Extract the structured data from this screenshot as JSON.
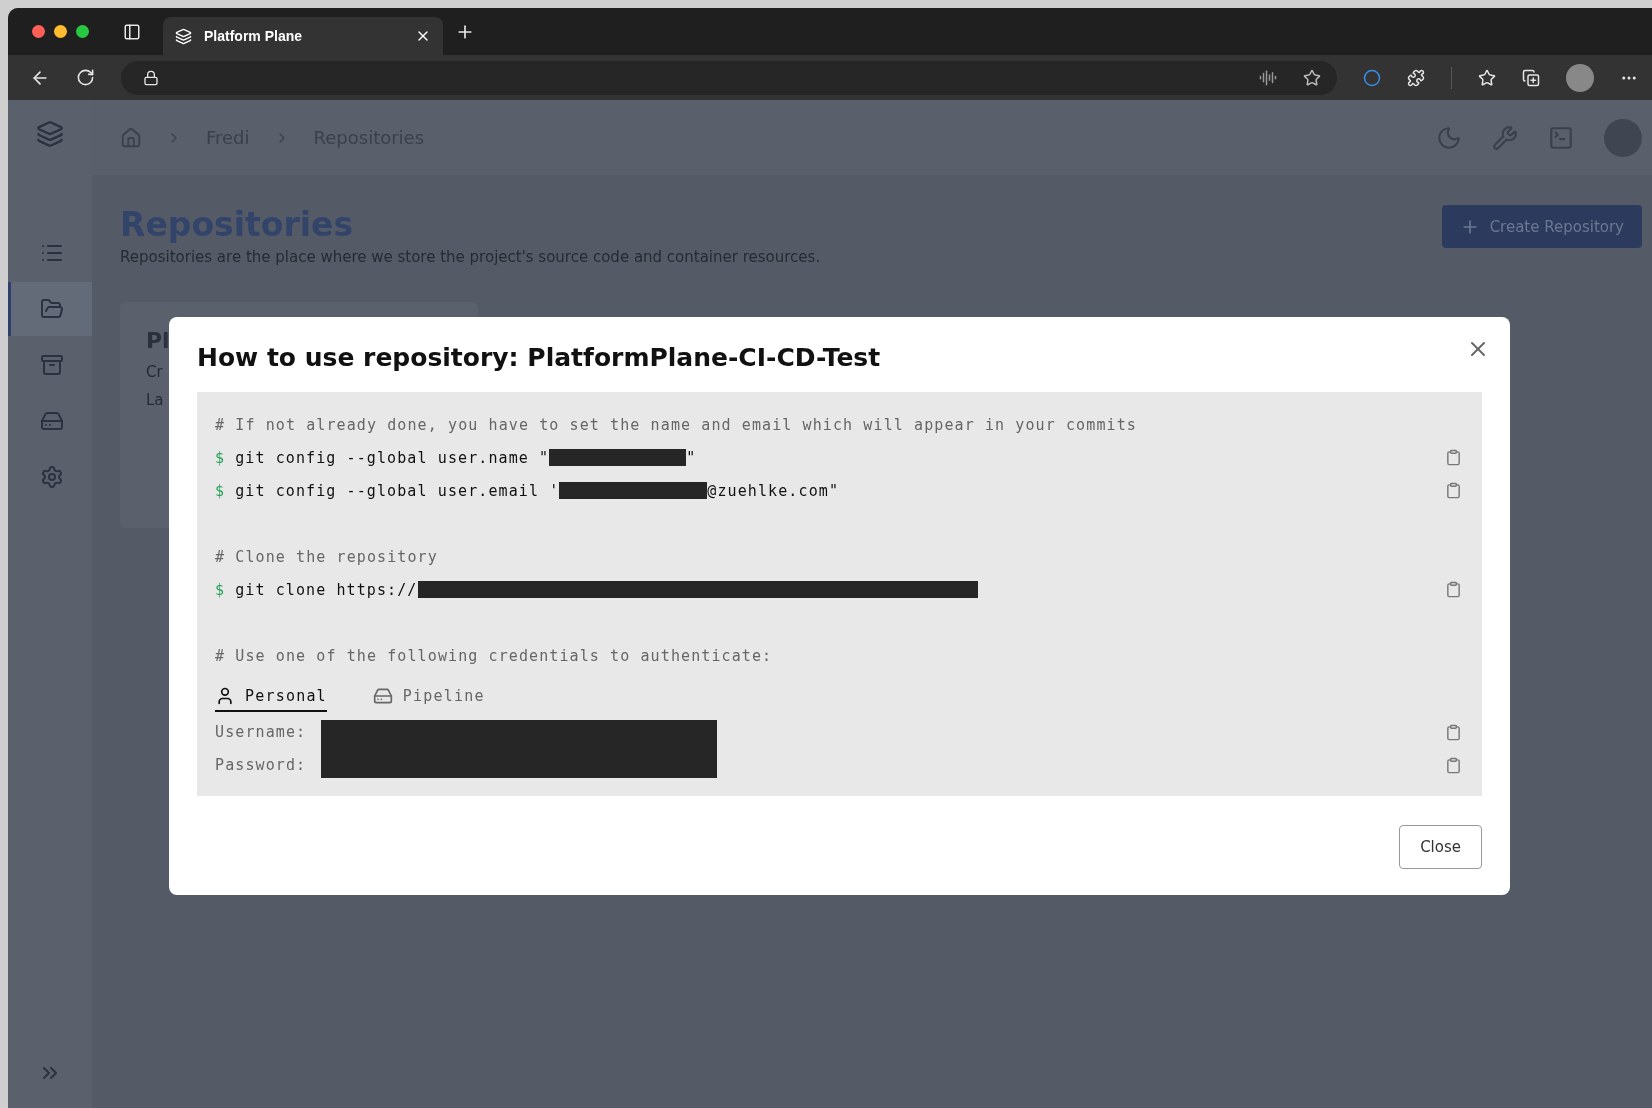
{
  "browser": {
    "tab": {
      "title": "Platform Plane"
    }
  },
  "breadcrumb": [
    "Fredi",
    "Repositories"
  ],
  "sidebar": {
    "items": [
      {
        "selected": false
      },
      {
        "selected": true
      },
      {
        "selected": false
      },
      {
        "selected": false
      },
      {
        "selected": false
      }
    ]
  },
  "page": {
    "title": "Repositories",
    "subtitle": "Repositories are the place where we store the project's source code and container resources.",
    "create_button": "Create Repository"
  },
  "card": {
    "title": "Pl",
    "lines": [
      "Cr",
      "La"
    ]
  },
  "modal": {
    "title": "How to use repository: PlatformPlane-CI-CD-Test",
    "lines": [
      {
        "kind": "comment",
        "text": "# If not already done, you have to set the name and email which will appear in your commits"
      },
      {
        "kind": "command",
        "prompt": "$",
        "text": "git config --global user.name \"",
        "redacted": true,
        "suffix": "\""
      },
      {
        "kind": "command",
        "prompt": "$",
        "text": "git config --global user.email '",
        "redacted": true,
        "suffix": "@zuehlke.com\""
      },
      {
        "kind": "blank"
      },
      {
        "kind": "comment",
        "text": "# Clone the repository"
      },
      {
        "kind": "command",
        "prompt": "$",
        "text": "git clone https://",
        "redacted": true
      },
      {
        "kind": "blank"
      },
      {
        "kind": "comment",
        "text": "# Use one of the following credentials to authenticate:"
      }
    ],
    "credential_tabs": [
      {
        "label": "Personal",
        "selected": true
      },
      {
        "label": "Pipeline",
        "selected": false
      }
    ],
    "fields": [
      "Username:",
      "Password:"
    ],
    "close_button": "Close"
  }
}
